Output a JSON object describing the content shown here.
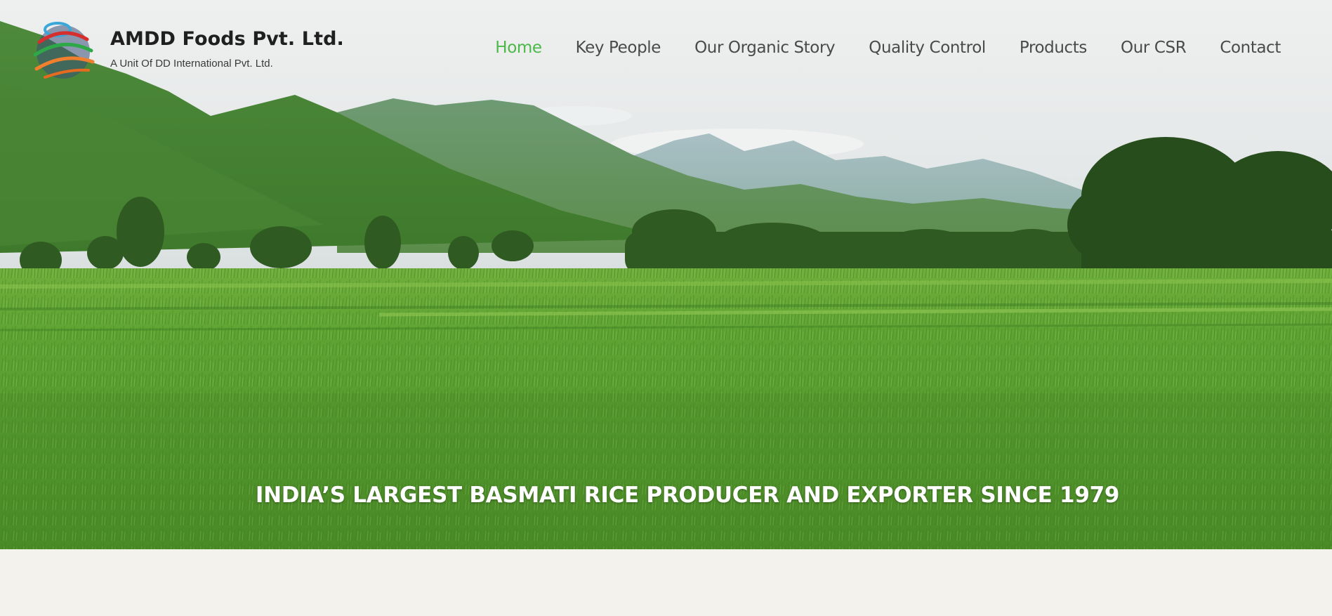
{
  "brand": {
    "name": "AMDD Foods Pvt. Ltd.",
    "tagline": "A Unit Of DD International Pvt. Ltd.",
    "logo_icon": "globe-logo-icon"
  },
  "nav": {
    "items": [
      {
        "label": "Home",
        "active": true
      },
      {
        "label": "Key People",
        "active": false
      },
      {
        "label": "Our Organic Story",
        "active": false
      },
      {
        "label": "Quality Control",
        "active": false
      },
      {
        "label": "Products",
        "active": false
      },
      {
        "label": "Our CSR",
        "active": false
      },
      {
        "label": "Contact",
        "active": false
      }
    ],
    "active_color": "#4cb849",
    "text_color": "#4a4a4a"
  },
  "hero": {
    "headline": "INDIA’S LARGEST BASMATI RICE PRODUCER AND EXPORTER SINCE 1979",
    "image": "rice-paddy-field-with-mountains"
  },
  "colors": {
    "page_background": "#f4f2ec",
    "brand_text": "#1f1f1f"
  }
}
